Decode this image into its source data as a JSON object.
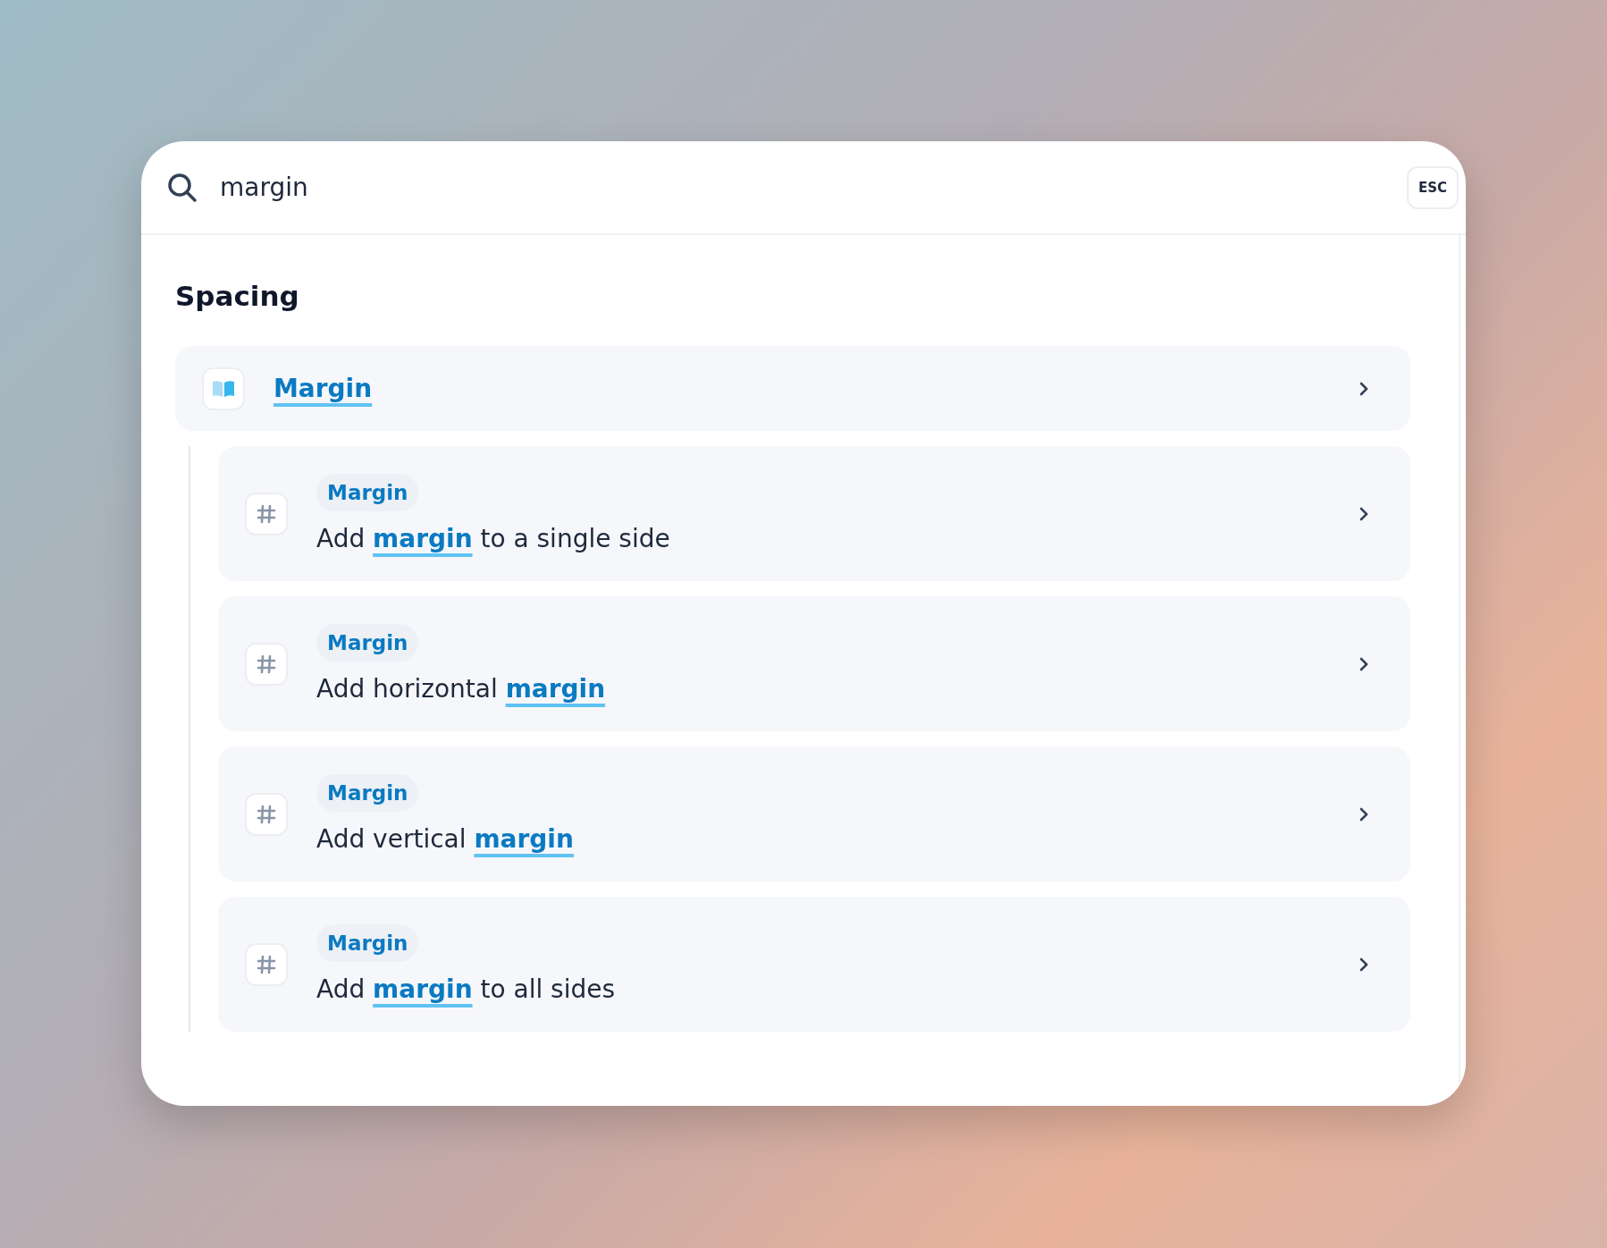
{
  "search": {
    "value": "margin",
    "shortcut": "ESC"
  },
  "section": {
    "title": "Spacing",
    "parent": {
      "title": "**Margin**"
    },
    "results": [
      {
        "tag": "Margin",
        "text": "Add **margin** to a single side"
      },
      {
        "tag": "Margin",
        "text": "Add horizontal **margin**"
      },
      {
        "tag": "Margin",
        "text": "Add vertical **margin**"
      },
      {
        "tag": "Margin",
        "text": "Add **margin** to all sides"
      }
    ]
  }
}
